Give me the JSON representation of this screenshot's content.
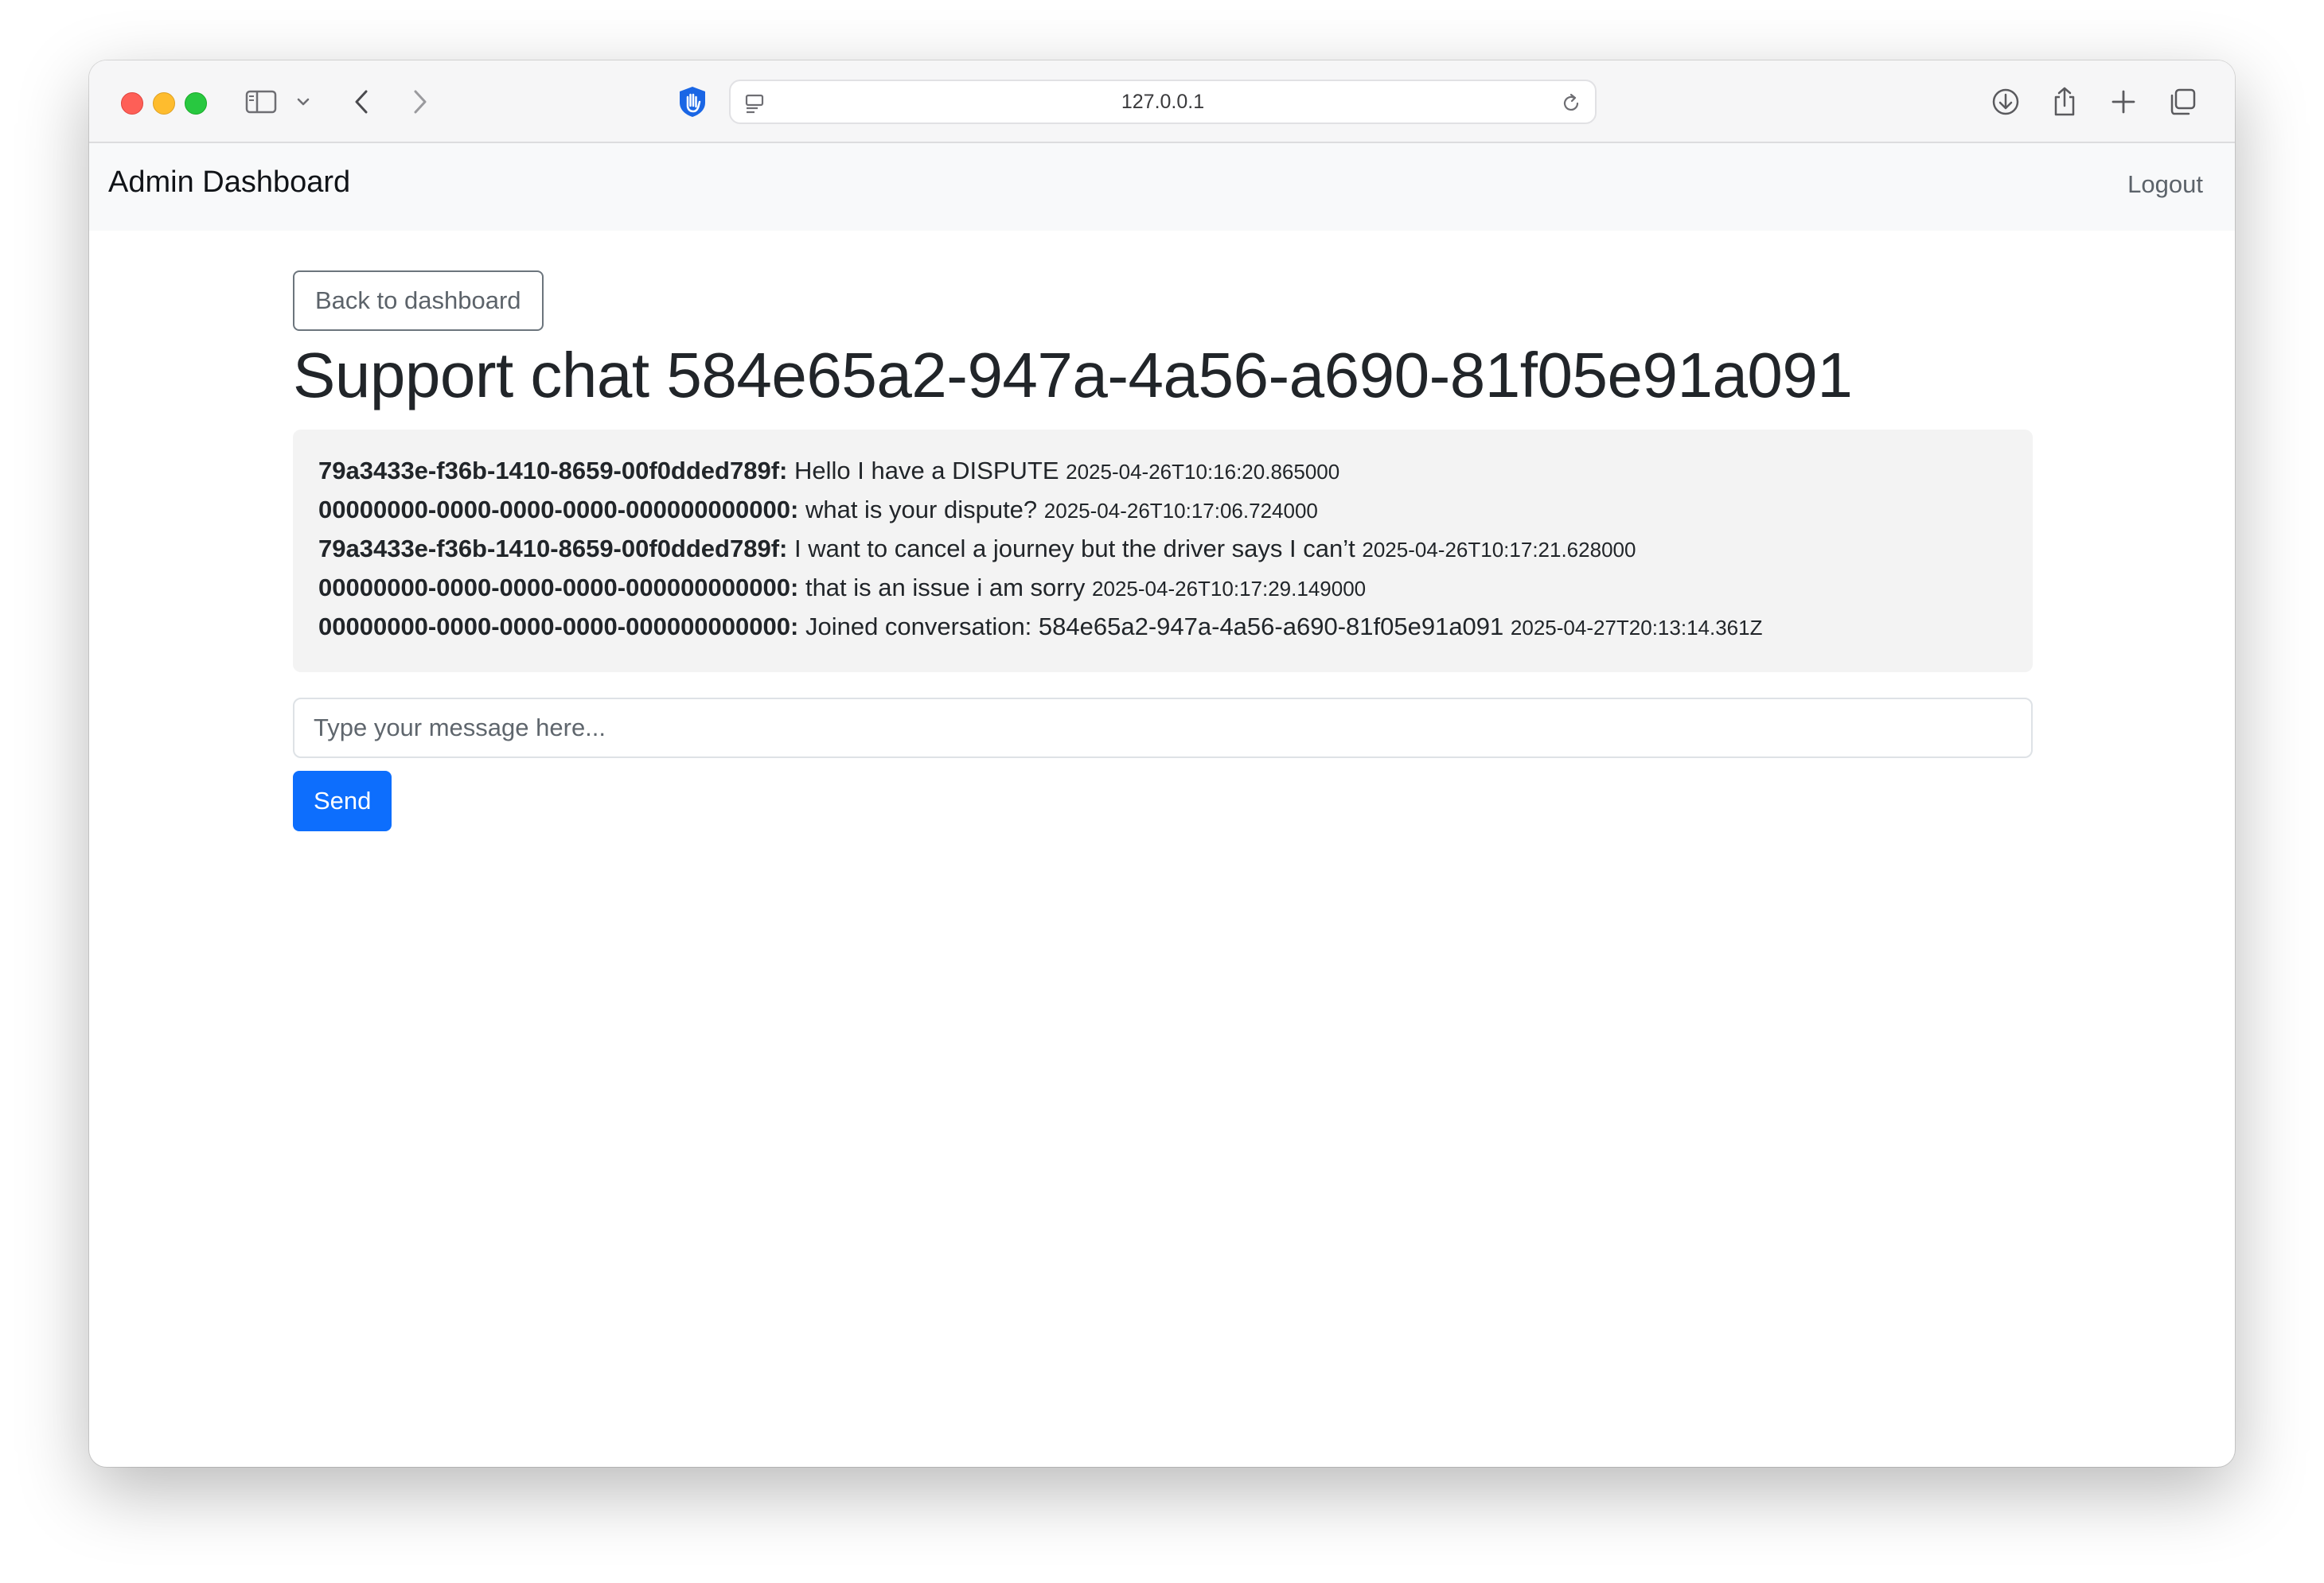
{
  "browser": {
    "url": "127.0.0.1",
    "icons": [
      "sidebar-icon",
      "chevron-down-icon",
      "back-arrow-icon",
      "forward-arrow-icon",
      "privacy-hand-icon",
      "page-menu-icon",
      "reload-icon",
      "download-icon",
      "share-icon",
      "new-tab-icon",
      "tabs-overview-icon"
    ]
  },
  "navbar": {
    "brand": "Admin Dashboard",
    "logout_label": "Logout"
  },
  "page": {
    "back_label": "Back to dashboard",
    "title": "Support chat 584e65a2-947a-4a56-a690-81f05e91a091"
  },
  "messages": [
    {
      "sender": "79a3433e-f36b-1410-8659-00f0dded789f:",
      "text": "Hello I have a DISPUTE",
      "timestamp": "2025-04-26T10:16:20.865000"
    },
    {
      "sender": "00000000-0000-0000-0000-000000000000:",
      "text": "what is your dispute?",
      "timestamp": "2025-04-26T10:17:06.724000"
    },
    {
      "sender": "79a3433e-f36b-1410-8659-00f0dded789f:",
      "text": "I want to cancel a journey but the driver says I can’t",
      "timestamp": "2025-04-26T10:17:21.628000"
    },
    {
      "sender": "00000000-0000-0000-0000-000000000000:",
      "text": "that is an issue i am sorry",
      "timestamp": "2025-04-26T10:17:29.149000"
    },
    {
      "sender": "00000000-0000-0000-0000-000000000000:",
      "text": "Joined conversation: 584e65a2-947a-4a56-a690-81f05e91a091",
      "timestamp": "2025-04-27T20:13:14.361Z"
    }
  ],
  "composer": {
    "value": "",
    "placeholder": "Type your message here...",
    "send_label": "Send"
  },
  "colors": {
    "primary": "#0d6efd",
    "navbar_bg": "#f8f9fa",
    "messages_bg": "#f3f3f3",
    "traffic_red": "#fe5f57",
    "traffic_yellow": "#febc2e",
    "traffic_green": "#28c840"
  }
}
